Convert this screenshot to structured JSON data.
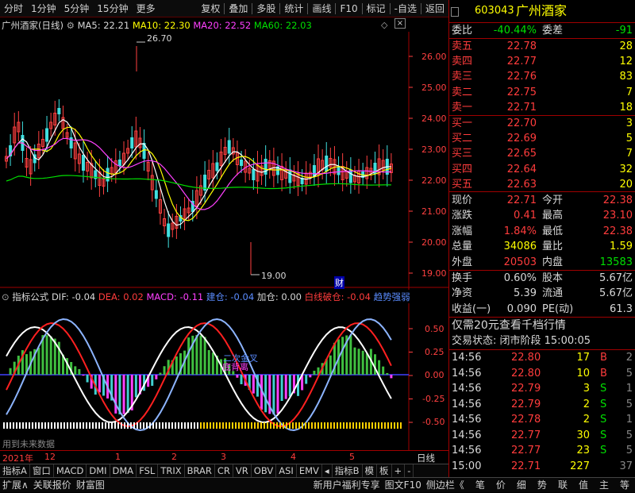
{
  "toolbar": {
    "items": [
      "分时",
      "1分钟",
      "5分钟",
      "15分钟",
      "更多",
      "复权",
      "叠加",
      "多股",
      "统计",
      "画线",
      "F10",
      "标记",
      "-自选",
      "返回"
    ]
  },
  "kline_header": {
    "title": "广州酒家(日线)",
    "ma5": "MA5: 22.21",
    "ma10": "MA10: 22.30",
    "ma20": "MA20: 22.52",
    "ma60": "MA60: 22.03"
  },
  "price_axis": [
    "26.00",
    "25.00",
    "24.00",
    "23.00",
    "22.00",
    "21.00",
    "20.00",
    "19.00"
  ],
  "annotations": {
    "high": "26.70",
    "low": "19.00",
    "cai": "财"
  },
  "indicator_header": {
    "name": "指标公式",
    "dif": "DIF: -0.04",
    "dea": "DEA: 0.02",
    "macd": "MACD: -0.11",
    "jiancang": "建仓: -0.04",
    "jiacang": "加仓: 0.00",
    "baixian": "白线破仓: -0.04",
    "qushi": "趋势强弱"
  },
  "indicator_axis": [
    "0.50",
    "0.25",
    "0.00",
    "-0.25",
    "-0.50"
  ],
  "indicator_labels": {
    "a": "二次金叉",
    "b": "底背离",
    "future": "用到未来数据"
  },
  "time_axis": {
    "year": "2021年",
    "m12": "12",
    "m1": "1",
    "m2": "2",
    "m3": "3",
    "m4": "4",
    "m5": "5",
    "period": "日线"
  },
  "bottom_tabs": [
    "指标A",
    "窗口",
    "MACD",
    "DMI",
    "DMA",
    "FSL",
    "TRIX",
    "BRAR",
    "CR",
    "VR",
    "OBV",
    "ASI",
    "EMV",
    "◂",
    "指标B",
    "模",
    "板",
    "+",
    "-"
  ],
  "status_bar": {
    "left": [
      "扩展∧",
      "关联报价",
      "财富图"
    ],
    "right": [
      "新用户福利专享",
      "图文F10",
      "侧边栏《"
    ],
    "tabs": [
      "笔",
      "价",
      "细",
      "势",
      "联",
      "值",
      "主",
      "等"
    ]
  },
  "quote": {
    "code": "603043",
    "name": "广州酒家",
    "weibi": {
      "label": "委比",
      "value": "-40.44%",
      "label2": "委差",
      "value2": "-91"
    },
    "asks": [
      {
        "label": "卖五",
        "price": "22.78",
        "vol": "28"
      },
      {
        "label": "卖四",
        "price": "22.77",
        "vol": "12"
      },
      {
        "label": "卖三",
        "price": "22.76",
        "vol": "83"
      },
      {
        "label": "卖二",
        "price": "22.75",
        "vol": "7"
      },
      {
        "label": "卖一",
        "price": "22.71",
        "vol": "18"
      }
    ],
    "bids": [
      {
        "label": "买一",
        "price": "22.70",
        "vol": "3"
      },
      {
        "label": "买二",
        "price": "22.69",
        "vol": "5"
      },
      {
        "label": "买三",
        "price": "22.65",
        "vol": "7"
      },
      {
        "label": "买四",
        "price": "22.64",
        "vol": "32"
      },
      {
        "label": "买五",
        "price": "22.63",
        "vol": "20"
      }
    ],
    "stats": [
      {
        "l1": "现价",
        "v1": "22.71",
        "l2": "今开",
        "v2": "22.38"
      },
      {
        "l1": "涨跌",
        "v1": "0.41",
        "l2": "最高",
        "v2": "23.10"
      },
      {
        "l1": "涨幅",
        "v1": "1.84%",
        "l2": "最低",
        "v2": "22.38"
      },
      {
        "l1": "总量",
        "v1": "34086",
        "l2": "量比",
        "v2": "1.59"
      },
      {
        "l1": "外盘",
        "v1": "20503",
        "l2": "内盘",
        "v2": "13583"
      }
    ],
    "stats2": [
      {
        "l1": "换手",
        "v1": "0.60%",
        "l2": "股本",
        "v2": "5.67亿"
      },
      {
        "l1": "净资",
        "v1": "5.39",
        "l2": "流通",
        "v2": "5.67亿"
      },
      {
        "l1": "收益(一)",
        "v1": "0.090",
        "l2": "PE(动)",
        "v2": "61.3"
      }
    ],
    "promo": "仅需20元查看千档行情",
    "trade_state": "交易状态: 闭市阶段 15:00:05",
    "ticks": [
      {
        "t": "14:56",
        "p": "22.80",
        "v": "17",
        "s": "B",
        "n": "2"
      },
      {
        "t": "14:56",
        "p": "22.80",
        "v": "10",
        "s": "B",
        "n": "5"
      },
      {
        "t": "14:56",
        "p": "22.79",
        "v": "3",
        "s": "S",
        "n": "1"
      },
      {
        "t": "14:56",
        "p": "22.79",
        "v": "2",
        "s": "S",
        "n": "5"
      },
      {
        "t": "14:56",
        "p": "22.78",
        "v": "2",
        "s": "S",
        "n": "1"
      },
      {
        "t": "14:56",
        "p": "22.77",
        "v": "30",
        "s": "S",
        "n": "5"
      },
      {
        "t": "14:56",
        "p": "22.77",
        "v": "23",
        "s": "S",
        "n": "5"
      },
      {
        "t": "15:00",
        "p": "22.71",
        "v": "227",
        "s": "",
        "n": "37"
      }
    ]
  },
  "colors": {
    "up": "#ff3c3c",
    "down": "#00e000",
    "ma5": "#ffffff",
    "ma10": "#ffff00",
    "ma20": "#ff40ff",
    "ma60": "#00e000"
  }
}
